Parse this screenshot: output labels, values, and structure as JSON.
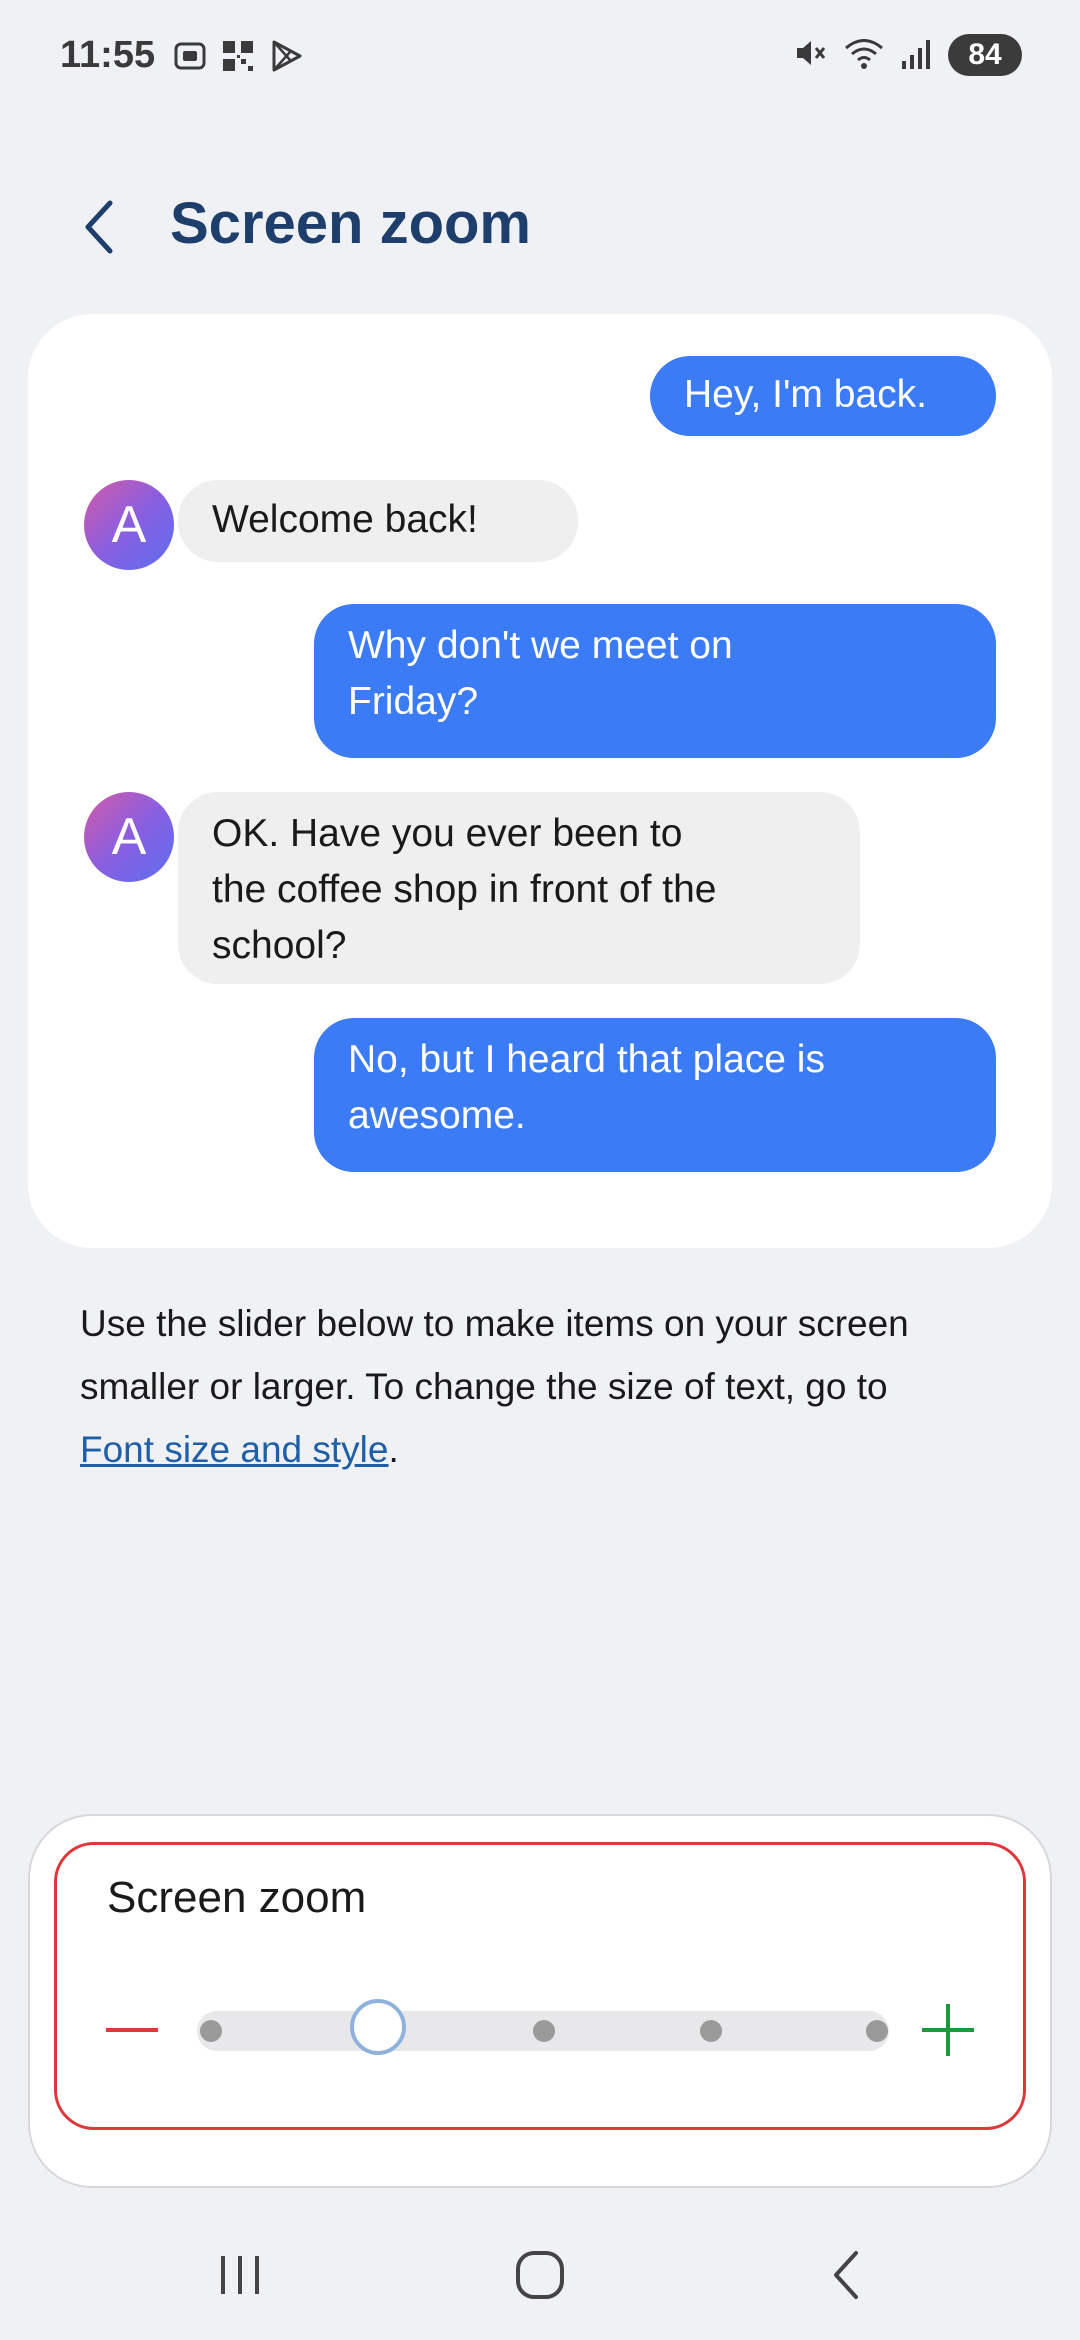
{
  "status_bar": {
    "time": "11:55",
    "battery": "84",
    "icons_left": [
      "screenshot-icon",
      "qr-icon",
      "play-store-icon"
    ],
    "icons_right": [
      "mute-icon",
      "wifi-icon",
      "signal-icon",
      "battery-icon"
    ]
  },
  "header": {
    "title": "Screen zoom",
    "back_icon": "chevron-left-icon"
  },
  "preview": {
    "avatar_letter": "A",
    "messages": [
      {
        "side": "sent",
        "text": "Hey, I'm back."
      },
      {
        "side": "received",
        "text": "Welcome back!"
      },
      {
        "side": "sent",
        "line1": "Why don't we meet on",
        "line2": "Friday?"
      },
      {
        "side": "received",
        "line1": "OK. Have you ever been to",
        "line2": "the coffee shop in front of the",
        "line3": "school?"
      },
      {
        "side": "sent",
        "line1": "No, but I heard that place is",
        "line2": "awesome."
      }
    ]
  },
  "description": {
    "line1": "Use the slider below to make items on your screen",
    "line2": "smaller or larger. To change the size of text, go to",
    "link_text": "Font size and style",
    "suffix": "."
  },
  "zoom": {
    "title": "Screen zoom",
    "levels": 5,
    "selected_level": 2,
    "minus_color": "#e0373b",
    "plus_color": "#1a9a3a"
  },
  "colors": {
    "accent": "#3b7cf6",
    "title": "#1e3f6b",
    "link": "#1f5fa8"
  }
}
